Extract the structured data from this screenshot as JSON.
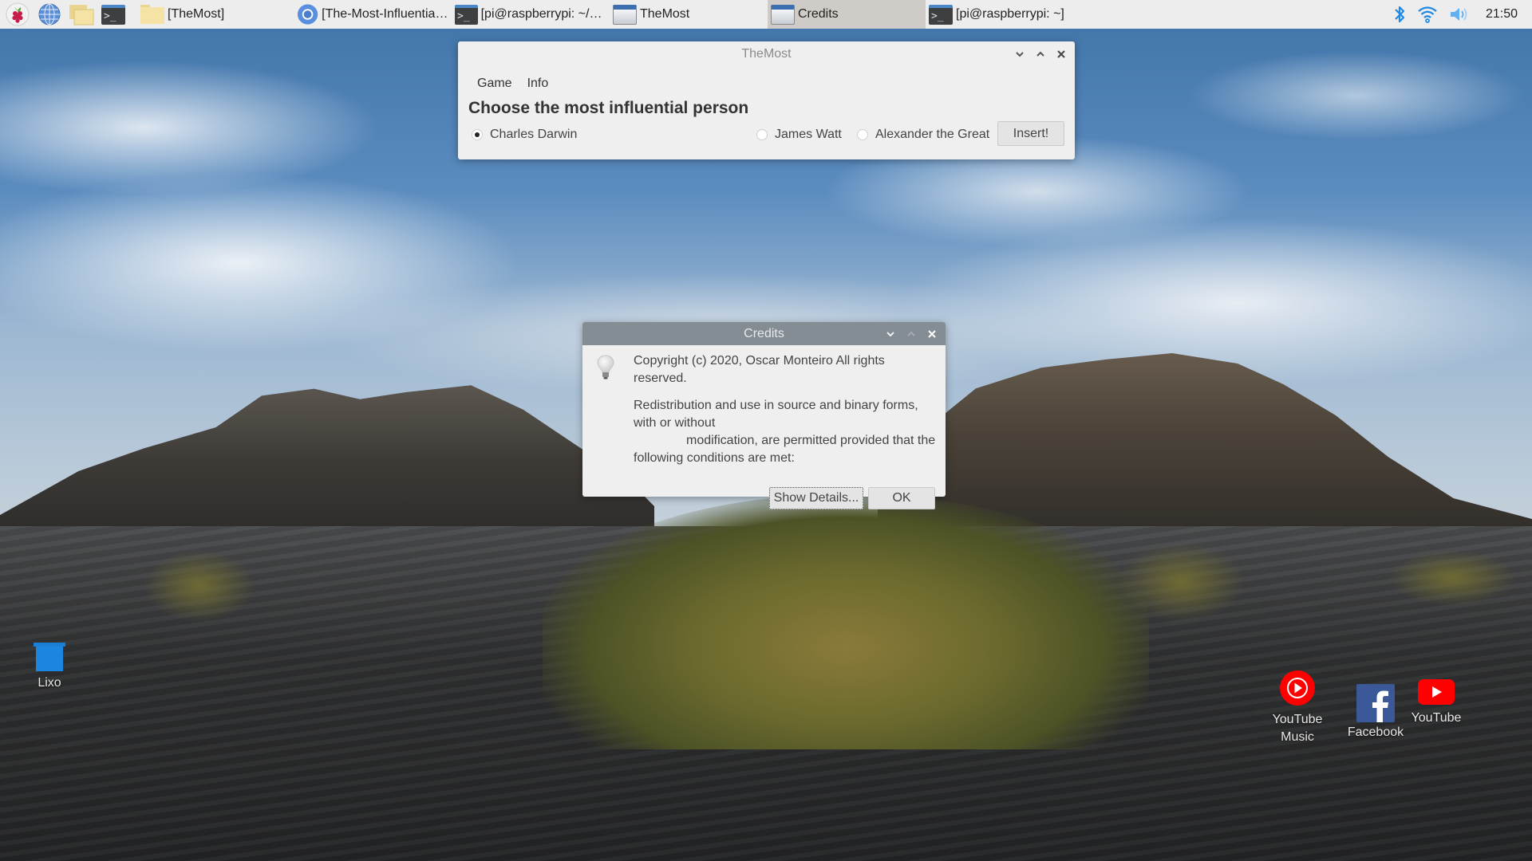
{
  "taskbar": {
    "launchers": [
      {
        "name": "raspberry-menu",
        "icon": "raspberry-icon"
      },
      {
        "name": "web-browser",
        "icon": "globe-icon"
      },
      {
        "name": "file-manager",
        "icon": "folder-icon"
      },
      {
        "name": "terminal",
        "icon": "terminal-icon"
      }
    ],
    "tasks": [
      {
        "label": "[TheMost]",
        "icon": "folder-icon",
        "active": false
      },
      {
        "label": "[The-Most-Influential ...",
        "icon": "chromium-icon",
        "active": false
      },
      {
        "label": "[pi@raspberrypi: ~/ex...",
        "icon": "terminal-icon",
        "active": false
      },
      {
        "label": "TheMost",
        "icon": "window-icon",
        "active": false
      },
      {
        "label": "Credits",
        "icon": "window-icon",
        "active": true
      },
      {
        "label": "[pi@raspberrypi: ~]",
        "icon": "terminal-icon",
        "active": false
      }
    ],
    "tray": {
      "bluetooth": "bluetooth-icon",
      "wifi": "wifi-icon",
      "volume": "volume-icon",
      "clock": "21:50"
    },
    "colors": {
      "tray_blue": "#1e88e5",
      "active_task_bg": "#cfccc7"
    }
  },
  "main_window": {
    "title": "TheMost",
    "menu": [
      "Game",
      "Info"
    ],
    "prompt": "Choose the most influential person",
    "options": [
      {
        "label": "Charles Darwin",
        "selected": true
      },
      {
        "label": "James Watt",
        "selected": false
      },
      {
        "label": "Alexander the Great",
        "selected": false
      }
    ],
    "insert_button": "Insert!"
  },
  "credits_dialog": {
    "title": "Credits",
    "icon": "lightbulb-icon",
    "copyright": "Copyright (c) 2020, Oscar Monteiro All rights reserved.",
    "license_line1": "Redistribution and use in source and binary forms, with or without",
    "license_line2": "modification, are permitted provided that the",
    "license_line3": "following conditions are met:",
    "show_details_button": "Show Details...",
    "ok_button": "OK"
  },
  "desktop_icons": [
    {
      "label": "Lixo",
      "icon": "trash-icon"
    },
    {
      "label": "YouTube Music",
      "icon": "youtube-music-icon"
    },
    {
      "label": "Facebook",
      "icon": "facebook-icon"
    },
    {
      "label": "YouTube",
      "icon": "youtube-icon"
    }
  ]
}
